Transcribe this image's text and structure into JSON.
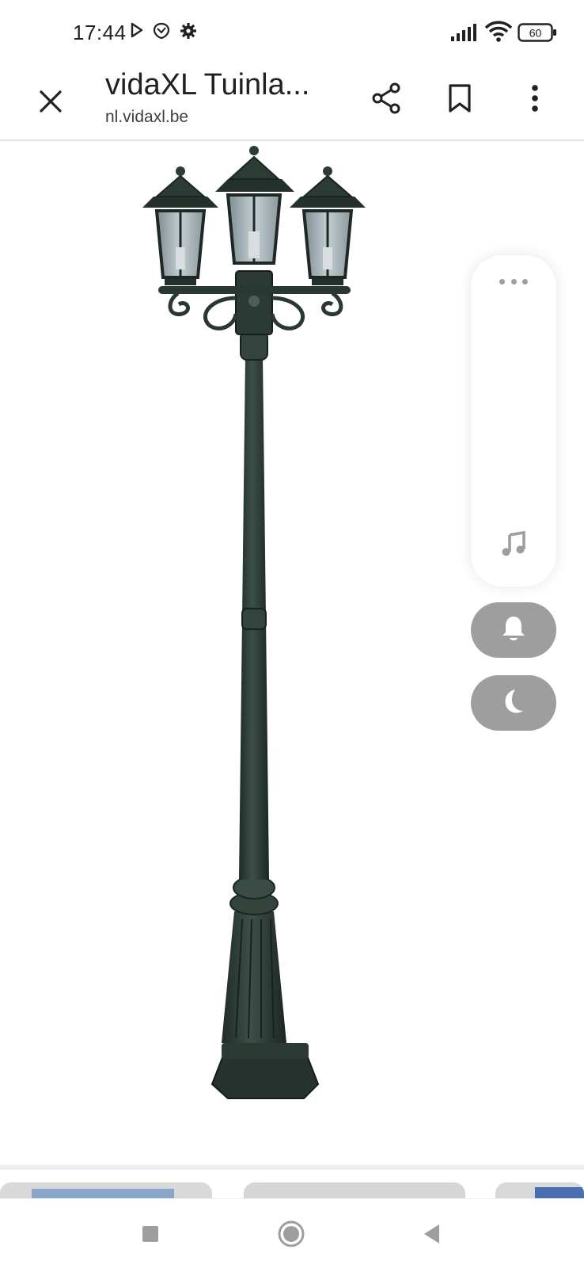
{
  "status_bar": {
    "time": "17:44",
    "icons": [
      "play-store-icon",
      "shield-icon",
      "settings-gear-icon",
      "signal-icon",
      "wifi-icon",
      "battery-icon"
    ],
    "battery_level": "60"
  },
  "app_bar": {
    "title": "vidaXL Tuinla...",
    "domain": "nl.vidaxl.be",
    "icons": [
      "close-icon",
      "share-icon",
      "bookmark-icon",
      "more-vert-icon"
    ]
  },
  "product_image": {
    "subject": "three-head garden lamp post",
    "colors": {
      "lamp": "#2e3f37",
      "glass": "#a9b6bc"
    }
  },
  "quick_panel": {
    "icons": [
      "more-dots-icon",
      "music-note-icon",
      "bell-icon",
      "moon-icon"
    ],
    "colors": {
      "pill": "#9e9e9e",
      "panel": "#ffffff"
    }
  },
  "nav_bar": {
    "icons": [
      "recents-square-icon",
      "home-circle-icon",
      "back-triangle-icon"
    ]
  }
}
